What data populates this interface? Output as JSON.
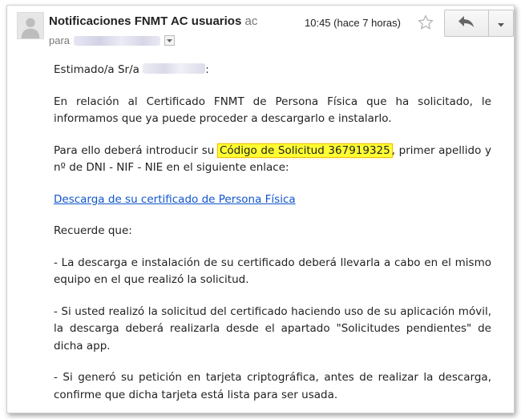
{
  "header": {
    "sender_name": "Notificaciones FNMT AC usuarios",
    "sender_extra": "ac",
    "to_prefix": "para",
    "time": "10:45 (hace 7 horas)"
  },
  "icons": {
    "avatar": "person-icon",
    "star": "star-outline-icon",
    "reply": "reply-arrow-icon",
    "more": "dropdown-caret-icon",
    "details": "show-details-caret-icon"
  },
  "colors": {
    "link": "#1155cc",
    "highlight": "#ffff33"
  },
  "body": {
    "greeting_prefix": "Estimado/a Sr/a",
    "greeting_suffix": ":",
    "para1": "En relación al Certificado FNMT de Persona Física que ha solicitado, le informamos que ya puede proceder a descargarlo e instalarlo.",
    "para2_before": "Para ello deberá introducir su",
    "para2_highlight": "Código de Solicitud 367919325",
    "para2_after": ", primer apellido y nº de DNI - NIF - NIE en el siguiente enlace:",
    "link_text": "Descarga de su certificado de Persona Física",
    "recuerde": "Recuerde que:",
    "item1": "- La descarga e instalación de su certificado deberá llevarla a cabo en el mismo equipo en el que realizó la solicitud.",
    "item2": "- Si usted realizó la solicitud del certificado haciendo uso de su aplicación móvil, la descarga deberá realizarla desde el apartado \"Solicitudes pendientes\" de dicha app.",
    "item3": "- Si generó su petición en tarjeta criptográfica, antes de realizar la descarga, confirme que dicha tarjeta está lista para ser usada."
  }
}
